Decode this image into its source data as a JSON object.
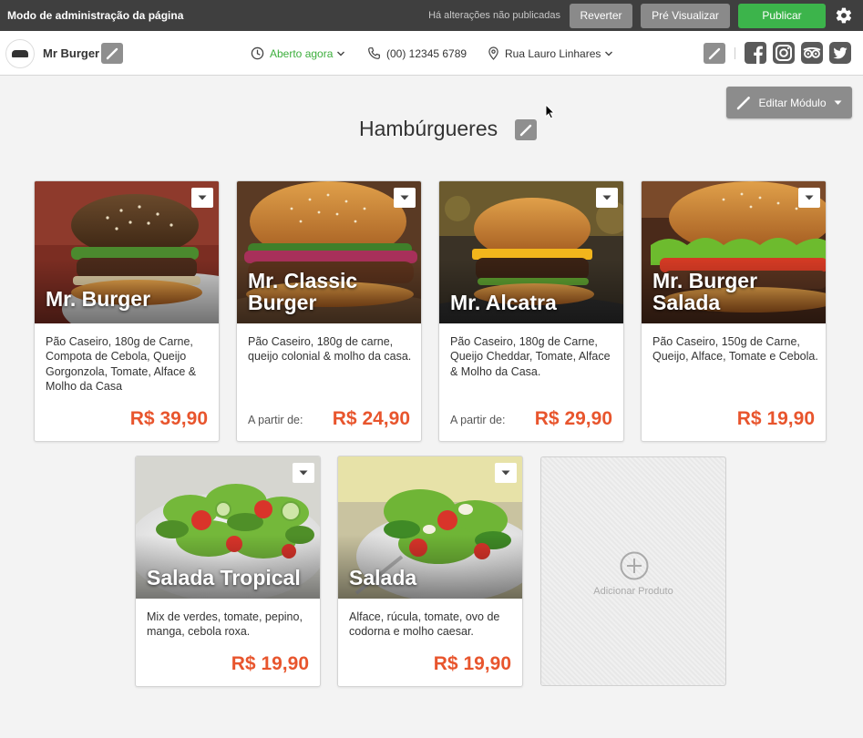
{
  "admin_bar": {
    "title": "Modo de administração da página",
    "status": "Há alterações não publicadas",
    "revert_label": "Reverter",
    "preview_label": "Pré Visualizar",
    "publish_label": "Publicar"
  },
  "header": {
    "brand": "Mr Burger",
    "hours_label": "Aberto agora",
    "phone": "(00) 12345 6789",
    "address": "Rua Lauro Linhares"
  },
  "section": {
    "title": "Hambúrgueres",
    "edit_module_label": "Editar Módulo"
  },
  "products": [
    {
      "name": "Mr. Burger",
      "description": "Pão Caseiro, 180g de Carne, Compota de Cebola, Queijo Gorgonzola, Tomate, Alface & Molho da Casa",
      "from_label": "",
      "price": "R$ 39,90"
    },
    {
      "name": "Mr. Classic Burger",
      "description": "Pão Caseiro, 180g de carne, queijo colonial & molho da casa.",
      "from_label": "A partir de:",
      "price": "R$ 24,90"
    },
    {
      "name": "Mr. Alcatra",
      "description": "Pão Caseiro, 180g de Carne, Queijo Cheddar, Tomate, Alface & Molho da Casa.",
      "from_label": "A partir de:",
      "price": "R$ 29,90"
    },
    {
      "name": "Mr. Burger Salada",
      "description": "Pão Caseiro, 150g de Carne, Queijo, Alface, Tomate e Cebola.",
      "from_label": "",
      "price": "R$ 19,90"
    },
    {
      "name": "Salada Tropical",
      "description": "Mix de verdes, tomate, pepino, manga, cebola roxa.",
      "from_label": "",
      "price": "R$ 19,90"
    },
    {
      "name": "Salada",
      "description": "Alface, rúcula, tomate, ovo de codorna e molho caesar.",
      "from_label": "",
      "price": "R$ 19,90"
    }
  ],
  "add_product": {
    "label": "Adicionar Produto"
  },
  "colors": {
    "admin_bg": "#3f3f3f",
    "publish_green": "#3cb44b",
    "price_orange": "#e8552d",
    "open_green": "#3cae3c"
  },
  "icons": [
    "gear-icon",
    "pencil-icon",
    "clock-icon",
    "phone-icon",
    "location-pin-icon",
    "chevron-down-icon",
    "facebook-icon",
    "instagram-icon",
    "tripadvisor-icon",
    "twitter-icon",
    "plus-circle-icon",
    "caret-down-icon"
  ]
}
